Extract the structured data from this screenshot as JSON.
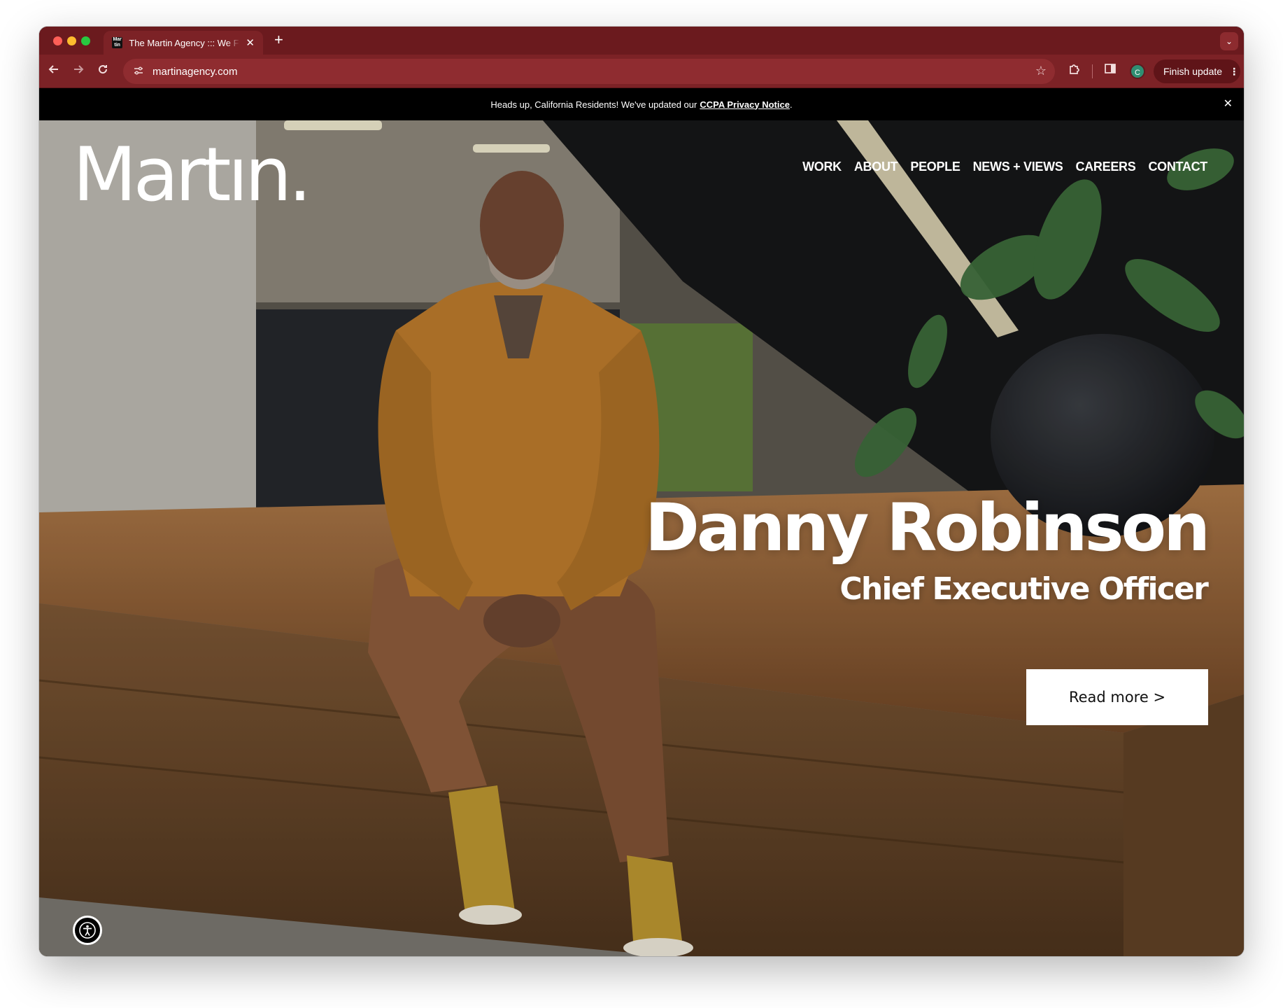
{
  "browser": {
    "tab_title": "The Martin Agency ::: We Fight",
    "tab_favicon": "Mar tin",
    "url": "martinagency.com",
    "finish_update_label": "Finish update",
    "profile_initial": "C"
  },
  "banner": {
    "text": "Heads up, California Residents! We've updated our",
    "link": "CCPA Privacy Notice",
    "suffix": "."
  },
  "site": {
    "logo": "Martın.",
    "nav": [
      "WORK",
      "ABOUT",
      "PEOPLE",
      "NEWS + VIEWS",
      "CAREERS",
      "CONTACT"
    ]
  },
  "hero": {
    "name": "Danny Robinson",
    "title": "Chief Executive Officer",
    "cta": "Read more >"
  },
  "icons": {
    "back": "arrow-left-icon",
    "forward": "arrow-right-icon",
    "reload": "reload-icon",
    "site_info": "tune-icon",
    "bookmark": "star-icon",
    "extensions": "puzzle-icon",
    "side_panel": "side-panel-icon",
    "accessibility": "accessibility-icon"
  }
}
